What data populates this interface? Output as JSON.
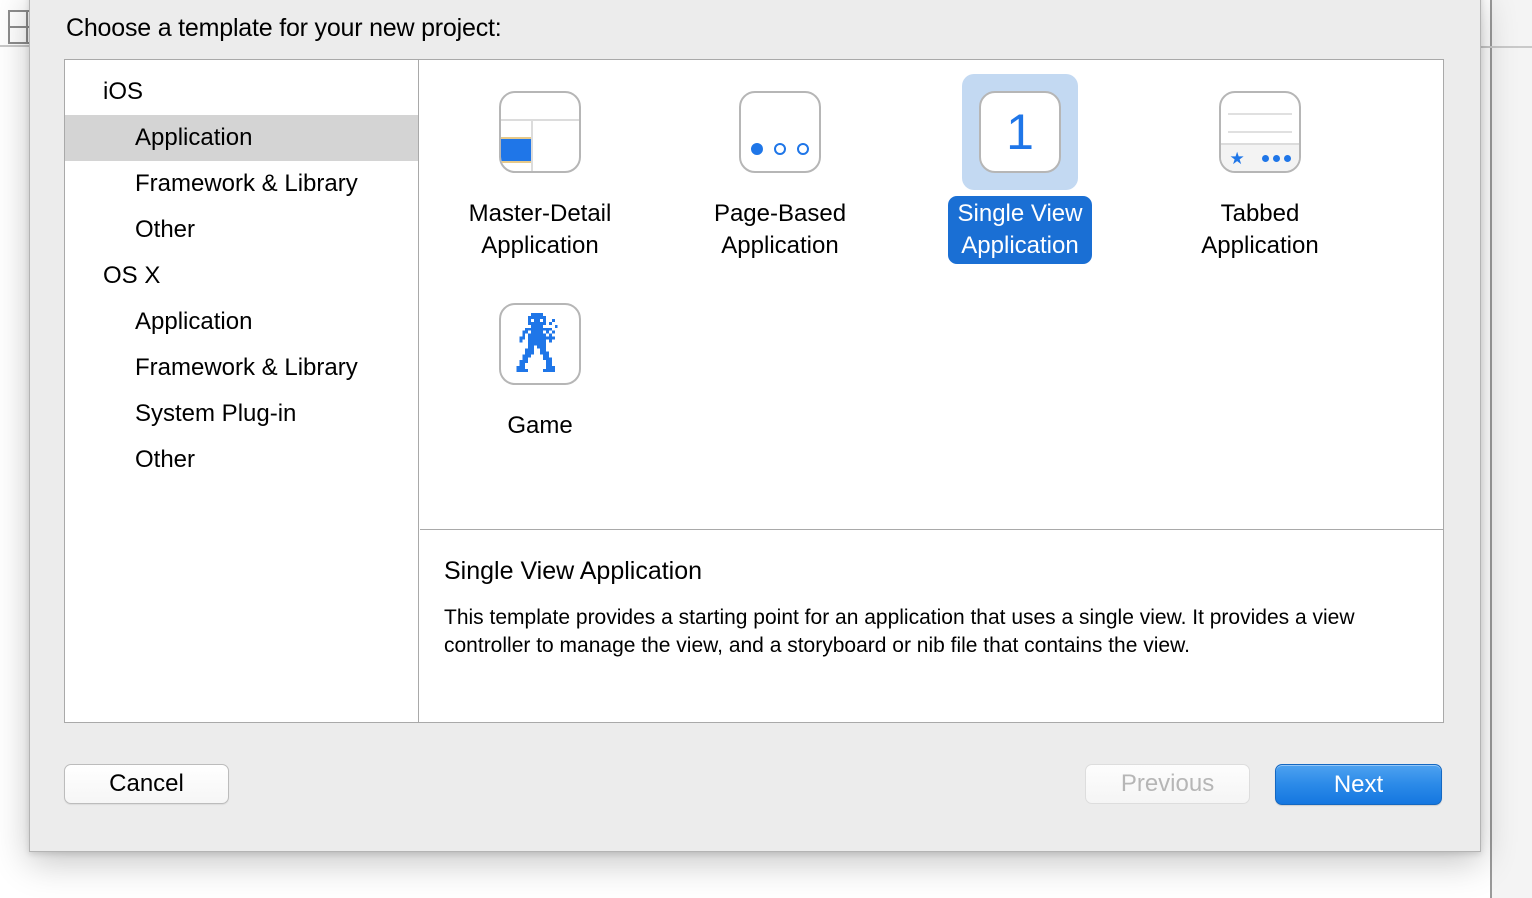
{
  "dialog": {
    "title": "Choose a template for your new project:"
  },
  "sidebar": {
    "items": [
      {
        "label": "iOS",
        "type": "group",
        "selected": false
      },
      {
        "label": "Application",
        "type": "child",
        "selected": true
      },
      {
        "label": "Framework & Library",
        "type": "child",
        "selected": false
      },
      {
        "label": "Other",
        "type": "child",
        "selected": false
      },
      {
        "label": "OS X",
        "type": "group",
        "selected": false
      },
      {
        "label": "Application",
        "type": "child",
        "selected": false
      },
      {
        "label": "Framework & Library",
        "type": "child",
        "selected": false
      },
      {
        "label": "System Plug-in",
        "type": "child",
        "selected": false
      },
      {
        "label": "Other",
        "type": "child",
        "selected": false
      }
    ]
  },
  "templates": [
    {
      "label": "Master-Detail\nApplication",
      "icon": "master-detail-icon",
      "selected": false
    },
    {
      "label": "Page-Based\nApplication",
      "icon": "page-based-icon",
      "selected": false
    },
    {
      "label": "Single View\nApplication",
      "icon": "single-view-icon",
      "selected": true
    },
    {
      "label": "Tabbed\nApplication",
      "icon": "tabbed-icon",
      "selected": false
    },
    {
      "label": "Game",
      "icon": "game-robot-icon",
      "selected": false
    }
  ],
  "single_view_number": "1",
  "description": {
    "title": "Single View Application",
    "body": "This template provides a starting point for an application that uses a single view. It provides a view controller to manage the view, and a storyboard or nib file that contains the view."
  },
  "footer": {
    "cancel_label": "Cancel",
    "previous_label": "Previous",
    "next_label": "Next"
  },
  "colors": {
    "accent_blue": "#1f76e8",
    "selection_pill": "#1a6fd4",
    "selection_icon_bg": "#c3d9f2",
    "sidebar_selection": "#d4d4d4",
    "next_button": "#2b8ae8",
    "sheet_background": "#ececec"
  }
}
